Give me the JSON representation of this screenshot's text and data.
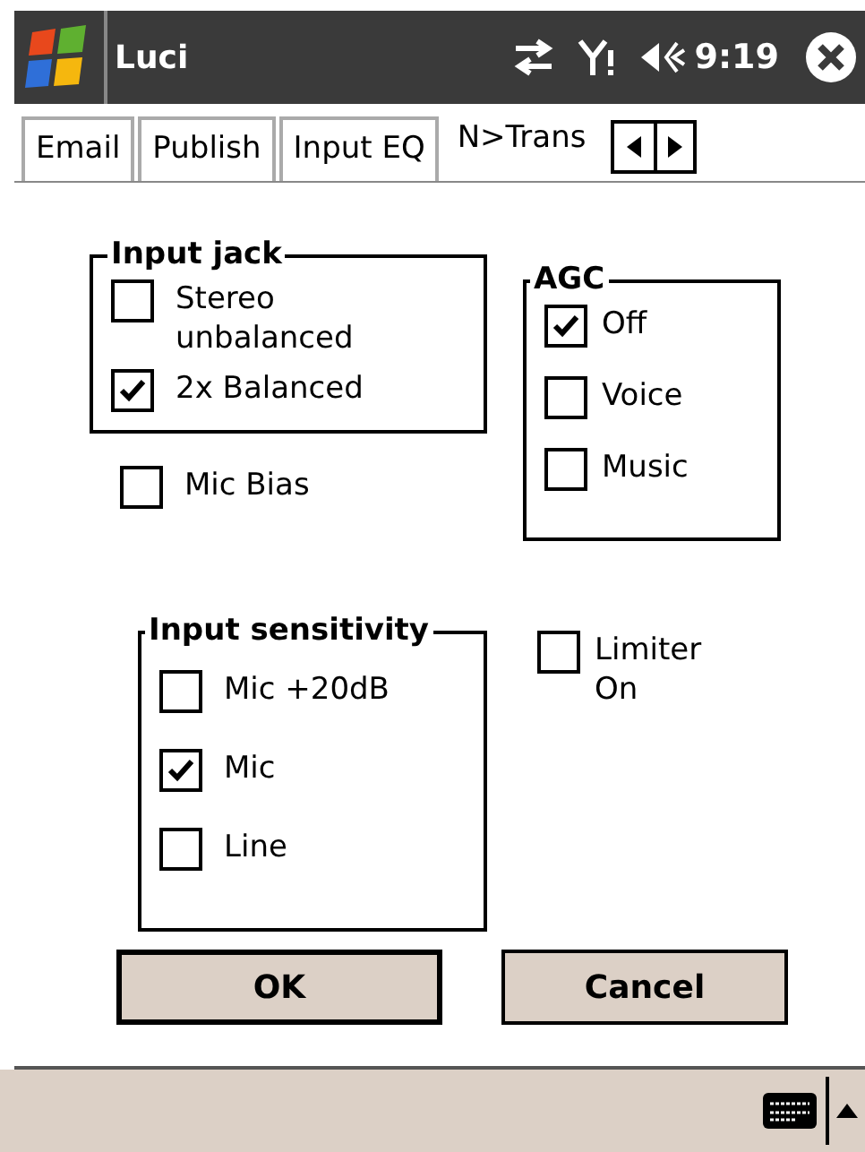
{
  "title_bar": {
    "title": "Luci",
    "time": "9:19"
  },
  "tabs": [
    {
      "label": "Email",
      "selected": false
    },
    {
      "label": "Publish",
      "selected": false
    },
    {
      "label": "Input EQ",
      "selected": false
    },
    {
      "label": "N>Trans",
      "selected": true
    }
  ],
  "input_jack": {
    "title": "Input jack",
    "options": [
      {
        "label": "Stereo unbalanced",
        "checked": false
      },
      {
        "label": "2x Balanced",
        "checked": true
      }
    ]
  },
  "mic_bias": {
    "label": "Mic Bias",
    "checked": false
  },
  "agc": {
    "title": "AGC",
    "options": [
      {
        "label": "Off",
        "checked": true
      },
      {
        "label": "Voice",
        "checked": false
      },
      {
        "label": "Music",
        "checked": false
      }
    ]
  },
  "input_sensitivity": {
    "title": "Input sensitivity",
    "options": [
      {
        "label": "Mic +20dB",
        "checked": false
      },
      {
        "label": "Mic",
        "checked": true
      },
      {
        "label": "Line",
        "checked": false
      }
    ]
  },
  "limiter": {
    "label": "Limiter On",
    "checked": false
  },
  "buttons": [
    "OK",
    "Cancel"
  ]
}
